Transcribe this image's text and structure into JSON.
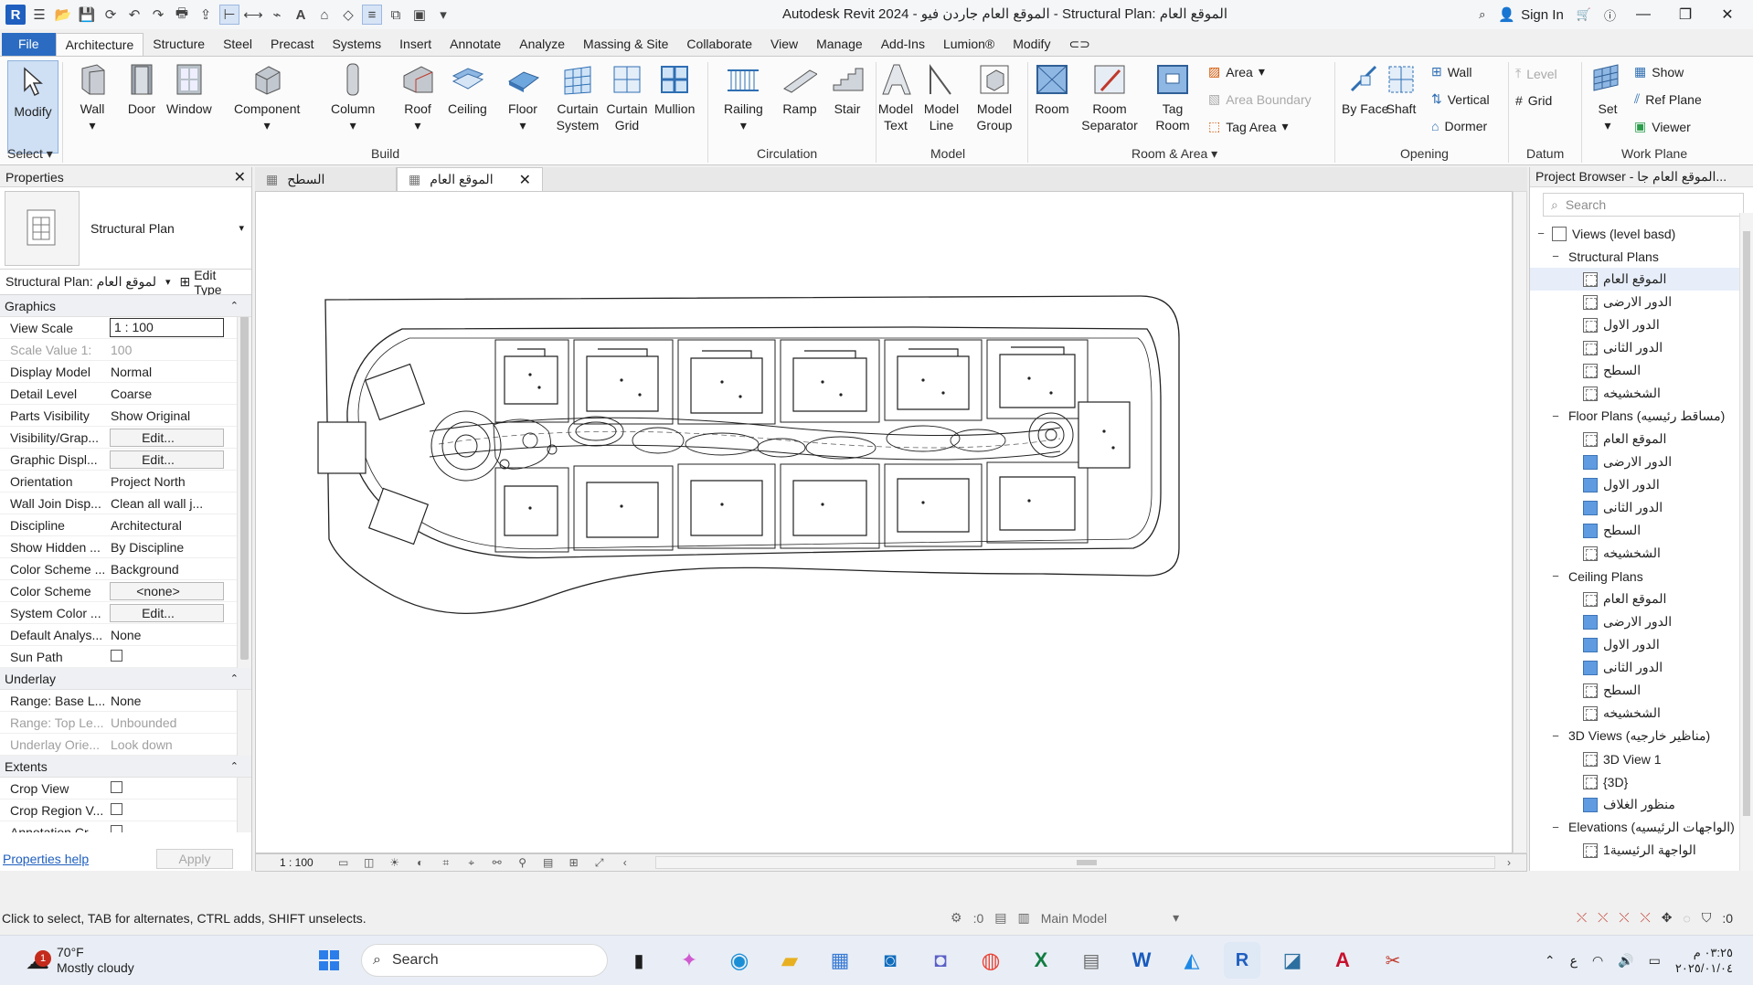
{
  "app": {
    "window_title": "Autodesk Revit 2024 - الموقع العام جاردن فيو - Structural Plan: الموقع العام",
    "sign_in": "Sign In",
    "logo_letter": "R"
  },
  "ribbon": {
    "tabs": [
      "File",
      "Architecture",
      "Structure",
      "Steel",
      "Precast",
      "Systems",
      "Insert",
      "Annotate",
      "Analyze",
      "Massing & Site",
      "Collaborate",
      "View",
      "Manage",
      "Add-Ins",
      "Lumion®",
      "Modify"
    ],
    "active_tab": "Architecture",
    "select_panel": {
      "modify": "Modify",
      "label": "Select"
    },
    "build": {
      "wall": "Wall",
      "door": "Door",
      "window": "Window",
      "component": "Component",
      "column": "Column",
      "roof": "Roof",
      "ceiling": "Ceiling",
      "floor": "Floor",
      "curtain_system": "Curtain System",
      "curtain_grid": "Curtain Grid",
      "mullion": "Mullion",
      "label": "Build"
    },
    "circulation": {
      "railing": "Railing",
      "ramp": "Ramp",
      "stair": "Stair",
      "label": "Circulation"
    },
    "model": {
      "model_text": "Model Text",
      "model_line": "Model Line",
      "model_group": "Model Group",
      "label": "Model"
    },
    "room_area": {
      "room": "Room",
      "room_separator": "Room Separator",
      "tag_room": "Tag Room",
      "area": "Area",
      "area_boundary": "Area Boundary",
      "tag_area": "Tag Area",
      "label": "Room & Area"
    },
    "opening": {
      "by_face": "By Face",
      "shaft": "Shaft",
      "wall": "Wall",
      "vertical": "Vertical",
      "dormer": "Dormer",
      "label": "Opening"
    },
    "datum": {
      "level": "Level",
      "grid": "Grid",
      "label": "Datum"
    },
    "work_plane": {
      "set": "Set",
      "show": "Show",
      "ref_plane": "Ref Plane",
      "viewer": "Viewer",
      "label": "Work Plane"
    }
  },
  "properties": {
    "title": "Properties",
    "type_name": "Structural Plan",
    "instance_selector": "Structural Plan: الموقع العام",
    "edit_type": "Edit Type",
    "groups": [
      {
        "name": "Graphics",
        "rows": [
          {
            "name": "View Scale",
            "value": "1 : 100",
            "kind": "box"
          },
          {
            "name": "Scale Value 1:",
            "value": "100",
            "kind": "dim"
          },
          {
            "name": "Display Model",
            "value": "Normal",
            "kind": "text"
          },
          {
            "name": "Detail Level",
            "value": "Coarse",
            "kind": "text"
          },
          {
            "name": "Parts Visibility",
            "value": "Show Original",
            "kind": "text"
          },
          {
            "name": "Visibility/Grap...",
            "value": "Edit...",
            "kind": "btn"
          },
          {
            "name": "Graphic Displ...",
            "value": "Edit...",
            "kind": "btn"
          },
          {
            "name": "Orientation",
            "value": "Project North",
            "kind": "text"
          },
          {
            "name": "Wall Join Disp...",
            "value": "Clean all wall j...",
            "kind": "text"
          },
          {
            "name": "Discipline",
            "value": "Architectural",
            "kind": "text"
          },
          {
            "name": "Show Hidden ...",
            "value": "By Discipline",
            "kind": "text"
          },
          {
            "name": "Color Scheme ...",
            "value": "Background",
            "kind": "text"
          },
          {
            "name": "Color Scheme",
            "value": "<none>",
            "kind": "btn"
          },
          {
            "name": "System Color ...",
            "value": "Edit...",
            "kind": "btn"
          },
          {
            "name": "Default Analys...",
            "value": "None",
            "kind": "text"
          },
          {
            "name": "Sun Path",
            "value": "",
            "kind": "check"
          }
        ]
      },
      {
        "name": "Underlay",
        "rows": [
          {
            "name": "Range: Base L...",
            "value": "None",
            "kind": "text"
          },
          {
            "name": "Range: Top Le...",
            "value": "Unbounded",
            "kind": "dim"
          },
          {
            "name": "Underlay Orie...",
            "value": "Look down",
            "kind": "dim"
          }
        ]
      },
      {
        "name": "Extents",
        "rows": [
          {
            "name": "Crop View",
            "value": "",
            "kind": "check"
          },
          {
            "name": "Crop Region V...",
            "value": "",
            "kind": "check"
          },
          {
            "name": "Annotation Cr...",
            "value": "",
            "kind": "check"
          }
        ]
      }
    ],
    "help_link": "Properties help",
    "apply": "Apply"
  },
  "doc_tabs": [
    {
      "label": "السطح",
      "active": false
    },
    {
      "label": "الموقع العام",
      "active": true
    }
  ],
  "view_control": {
    "scale": "1 : 100"
  },
  "browser": {
    "title": "Project Browser - الموقع العام جا...",
    "search_placeholder": "Search",
    "nodes": [
      {
        "level": 0,
        "exp": "−",
        "icon": "views",
        "label": "Views (level basd)"
      },
      {
        "level": 1,
        "exp": "−",
        "icon": "",
        "label": "Structural Plans"
      },
      {
        "level": 2,
        "exp": "",
        "icon": "dash",
        "label": "الموقع العام",
        "selected": true
      },
      {
        "level": 2,
        "exp": "",
        "icon": "dash",
        "label": "الدور الارضى"
      },
      {
        "level": 2,
        "exp": "",
        "icon": "dash",
        "label": "الدور الاول"
      },
      {
        "level": 2,
        "exp": "",
        "icon": "dash",
        "label": "الدور الثانى"
      },
      {
        "level": 2,
        "exp": "",
        "icon": "dash",
        "label": "السطح"
      },
      {
        "level": 2,
        "exp": "",
        "icon": "dash",
        "label": "الشخشيخه"
      },
      {
        "level": 1,
        "exp": "−",
        "icon": "",
        "label": "Floor Plans (مساقط رئيسيه)"
      },
      {
        "level": 2,
        "exp": "",
        "icon": "dash",
        "label": "الموقع العام"
      },
      {
        "level": 2,
        "exp": "",
        "icon": "blue",
        "label": "الدور الارضى"
      },
      {
        "level": 2,
        "exp": "",
        "icon": "blue",
        "label": "الدور الاول"
      },
      {
        "level": 2,
        "exp": "",
        "icon": "blue",
        "label": "الدور الثانى"
      },
      {
        "level": 2,
        "exp": "",
        "icon": "blue",
        "label": "السطح"
      },
      {
        "level": 2,
        "exp": "",
        "icon": "dash",
        "label": "الشخشيخه"
      },
      {
        "level": 1,
        "exp": "−",
        "icon": "",
        "label": "Ceiling Plans"
      },
      {
        "level": 2,
        "exp": "",
        "icon": "dash",
        "label": "الموقع العام"
      },
      {
        "level": 2,
        "exp": "",
        "icon": "blue",
        "label": "الدور الارضى"
      },
      {
        "level": 2,
        "exp": "",
        "icon": "blue",
        "label": "الدور الاول"
      },
      {
        "level": 2,
        "exp": "",
        "icon": "blue",
        "label": "الدور الثانى"
      },
      {
        "level": 2,
        "exp": "",
        "icon": "dash",
        "label": "السطح"
      },
      {
        "level": 2,
        "exp": "",
        "icon": "dash",
        "label": "الشخشيخه"
      },
      {
        "level": 1,
        "exp": "−",
        "icon": "",
        "label": "3D Views (مناظير خارجيه)"
      },
      {
        "level": 2,
        "exp": "",
        "icon": "dash",
        "label": "3D View 1"
      },
      {
        "level": 2,
        "exp": "",
        "icon": "dash",
        "label": "{3D}"
      },
      {
        "level": 2,
        "exp": "",
        "icon": "blue",
        "label": "منظور الغلاف"
      },
      {
        "level": 1,
        "exp": "−",
        "icon": "",
        "label": "Elevations (الواجهات الرئيسيه)"
      },
      {
        "level": 2,
        "exp": "",
        "icon": "dash",
        "label": "الواجهة الرئيسية1"
      }
    ]
  },
  "status": {
    "message": "Click to select, TAB for alternates, CTRL adds, SHIFT unselects.",
    "workset_count": ":0",
    "model": "Main Model",
    "filter_count": ":0"
  },
  "taskbar": {
    "temperature": "70°F",
    "weather": "Mostly cloudy",
    "notification_count": "1",
    "search": "Search",
    "time": "٠٣:٢٥ م",
    "date": "٢٠٢٥/٠١/٠٤",
    "language": "ع"
  },
  "colors": {
    "accent": "#2b6cc2",
    "ribbon_bg": "#fbfbfb",
    "selection_bg": "#cfe0f5",
    "view_icon_blue": "#5f9be0"
  }
}
